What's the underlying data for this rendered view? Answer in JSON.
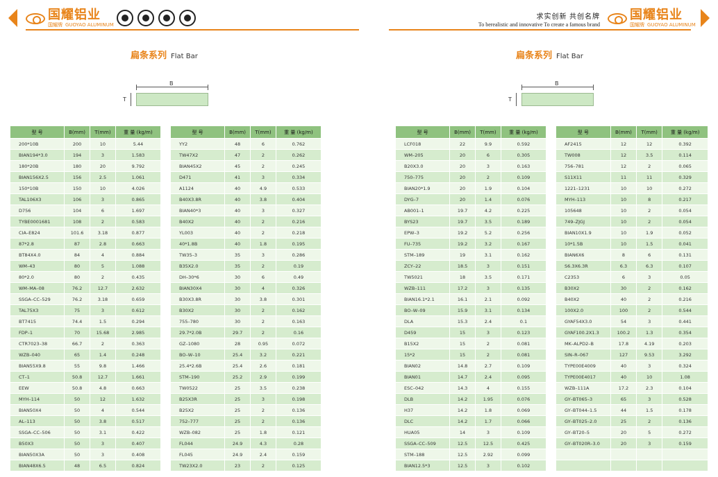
{
  "header": {
    "brand_cn": "国耀铝业",
    "brand_small_cn": "国耀牌",
    "brand_en": "GUOYAO ALUMINUM",
    "slogan_cn": "求实创新  共创名牌",
    "slogan_en": "To berealistic and innovative   To create a famous brand",
    "accent_color": "#e8841a",
    "badge_icons": [
      "certification-seal-icon",
      "ce-mark-icon",
      "quality-gear-icon",
      "triangle-mark-icon"
    ]
  },
  "section": {
    "title_cn": "扁条系列",
    "title_en": "Flat Bar",
    "diagram_label_B": "B",
    "diagram_label_T": "T"
  },
  "columns": [
    "型 号",
    "B(mm)",
    "T(mm)",
    "重 量 (kg/m)"
  ],
  "table1": [
    [
      "200*10B",
      "200",
      "10",
      "5.44"
    ],
    [
      "BIAN194*3.0",
      "194",
      "3",
      "1.583"
    ],
    [
      "180*20B",
      "180",
      "20",
      "9.792"
    ],
    [
      "BIAN156X2.5",
      "156",
      "2.5",
      "1.061"
    ],
    [
      "150*10B",
      "150",
      "10",
      "4.026"
    ],
    [
      "TAL106X3",
      "106",
      "3",
      "0.865"
    ],
    [
      "D756",
      "104",
      "6",
      "1.697"
    ],
    [
      "TYBE0001681",
      "108",
      "2",
      "0.583"
    ],
    [
      "CIA–E824",
      "101.6",
      "3.18",
      "0.877"
    ],
    [
      "87*2.8",
      "87",
      "2.8",
      "0.663"
    ],
    [
      "BT84X4.0",
      "84",
      "4",
      "0.884"
    ],
    [
      "WM–43",
      "80",
      "5",
      "1.088"
    ],
    [
      "80*2.0",
      "80",
      "2",
      "0.435"
    ],
    [
      "WM–MA–08",
      "76.2",
      "12.7",
      "2.632"
    ],
    [
      "SSGA–CC–529",
      "76.2",
      "3.18",
      "0.659"
    ],
    [
      "TAL75X3",
      "75",
      "3",
      "0.612"
    ],
    [
      "BT7415",
      "74.4",
      "1.5",
      "0.294"
    ],
    [
      "FDP–1",
      "70",
      "15.68",
      "2.985"
    ],
    [
      "CTR7023–38",
      "66.7",
      "2",
      "0.363"
    ],
    [
      "WZB–040",
      "65",
      "1.4",
      "0.248"
    ],
    [
      "BIAN55X9.8",
      "55",
      "9.8",
      "1.466"
    ],
    [
      "CT–1",
      "50.8",
      "12.7",
      "1.661"
    ],
    [
      "EEW",
      "50.8",
      "4.8",
      "0.663"
    ],
    [
      "MYH–114",
      "50",
      "12",
      "1.632"
    ],
    [
      "BIAN50X4",
      "50",
      "4",
      "0.544"
    ],
    [
      "AL–113",
      "50",
      "3.8",
      "0.517"
    ],
    [
      "SSGA–CC–506",
      "50",
      "3.1",
      "0.422"
    ],
    [
      "B50X3",
      "50",
      "3",
      "0.407"
    ],
    [
      "BIAN50X3A",
      "50",
      "3",
      "0.408"
    ],
    [
      "BIAN48X6.5",
      "48",
      "6.5",
      "0.824"
    ]
  ],
  "table2": [
    [
      "YY2",
      "48",
      "6",
      "0.762"
    ],
    [
      "TW47X2",
      "47",
      "2",
      "0.262"
    ],
    [
      "BIAN45X2",
      "45",
      "2",
      "0.245"
    ],
    [
      "D471",
      "41",
      "3",
      "0.334"
    ],
    [
      "A1124",
      "40",
      "4.9",
      "0.533"
    ],
    [
      "B40X3.8R",
      "40",
      "3.8",
      "0.404"
    ],
    [
      "BIAN40*3",
      "40",
      "3",
      "0.327"
    ],
    [
      "B40X2",
      "40",
      "2",
      "0.216"
    ],
    [
      "YL003",
      "40",
      "2",
      "0.218"
    ],
    [
      "40*1.8B",
      "40",
      "1.8",
      "0.195"
    ],
    [
      "TW35–3",
      "35",
      "3",
      "0.286"
    ],
    [
      "B35X2.0",
      "35",
      "2",
      "0.19"
    ],
    [
      "DH–30*6",
      "30",
      "6",
      "0.49"
    ],
    [
      "BIAN30X4",
      "30",
      "4",
      "0.326"
    ],
    [
      "B30X3.8R",
      "30",
      "3.8",
      "0.301"
    ],
    [
      "B30X2",
      "30",
      "2",
      "0.162"
    ],
    [
      "755–780",
      "30",
      "2",
      "0.163"
    ],
    [
      "29.7*2.0B",
      "29.7",
      "2",
      "0.16"
    ],
    [
      "GZ–1080",
      "28",
      "0.95",
      "0.072"
    ],
    [
      "BO–W–10",
      "25.4",
      "3.2",
      "0.221"
    ],
    [
      "25.4*2.6B",
      "25.4",
      "2.6",
      "0.181"
    ],
    [
      "STM–190",
      "25.2",
      "2.9",
      "0.199"
    ],
    [
      "TW0522",
      "25",
      "3.5",
      "0.238"
    ],
    [
      "B25X3R",
      "25",
      "3",
      "0.198"
    ],
    [
      "B25X2",
      "25",
      "2",
      "0.136"
    ],
    [
      "752–777",
      "25",
      "2",
      "0.136"
    ],
    [
      "WZB–082",
      "25",
      "1.8",
      "0.121"
    ],
    [
      "FL044",
      "24.9",
      "4.3",
      "0.28"
    ],
    [
      "FL045",
      "24.9",
      "2.4",
      "0.159"
    ],
    [
      "TW23X2.0",
      "23",
      "2",
      "0.125"
    ]
  ],
  "table3": [
    [
      "LCF018",
      "22",
      "9.9",
      "0.592"
    ],
    [
      "WM–205",
      "20",
      "6",
      "0.305"
    ],
    [
      "B20X3.0",
      "20",
      "3",
      "0.163"
    ],
    [
      "750–775",
      "20",
      "2",
      "0.109"
    ],
    [
      "BIAN20*1.9",
      "20",
      "1.9",
      "0.104"
    ],
    [
      "DYG–7",
      "20",
      "1.4",
      "0.076"
    ],
    [
      "AB001–1",
      "19.7",
      "4.2",
      "0.225"
    ],
    [
      "BYS23",
      "19.7",
      "3.5",
      "0.189"
    ],
    [
      "EPW–3",
      "19.2",
      "5.2",
      "0.256"
    ],
    [
      "FU–735",
      "19.2",
      "3.2",
      "0.167"
    ],
    [
      "STM–189",
      "19",
      "3.1",
      "0.162"
    ],
    [
      "ZCY–22",
      "18.5",
      "3",
      "0.151"
    ],
    [
      "TW5021",
      "18",
      "3.5",
      "0.171"
    ],
    [
      "WZB–111",
      "17.2",
      "3",
      "0.135"
    ],
    [
      "BIAN16.1*2.1",
      "16.1",
      "2.1",
      "0.092"
    ],
    [
      "BO–W–09",
      "15.9",
      "3.1",
      "0.134"
    ],
    [
      "DLA",
      "15.3",
      "2.4",
      "0.1"
    ],
    [
      "D459",
      "15",
      "3",
      "0.123"
    ],
    [
      "B15X2",
      "15",
      "2",
      "0.081"
    ],
    [
      "15*2",
      "15",
      "2",
      "0.081"
    ],
    [
      "BIAN02",
      "14.8",
      "2.7",
      "0.109"
    ],
    [
      "BIAN01",
      "14.7",
      "2.4",
      "0.095"
    ],
    [
      "ESC–042",
      "14.3",
      "4",
      "0.155"
    ],
    [
      "DLB",
      "14.2",
      "1.95",
      "0.076"
    ],
    [
      "H37",
      "14.2",
      "1.8",
      "0.069"
    ],
    [
      "DLC",
      "14.2",
      "1.7",
      "0.066"
    ],
    [
      "HUA05",
      "14",
      "3",
      "0.109"
    ],
    [
      "SSGA–CC–509",
      "12.5",
      "12.5",
      "0.425"
    ],
    [
      "STM–188",
      "12.5",
      "2.92",
      "0.099"
    ],
    [
      "BIAN12.5*3",
      "12.5",
      "3",
      "0.102"
    ]
  ],
  "table4": [
    [
      "AF2415",
      "12",
      "12",
      "0.392"
    ],
    [
      "TW008",
      "12",
      "3.5",
      "0.114"
    ],
    [
      "756–781",
      "12",
      "2",
      "0.065"
    ],
    [
      "S11X11",
      "11",
      "11",
      "0.329"
    ],
    [
      "1221–1231",
      "10",
      "10",
      "0.272"
    ],
    [
      "MYH–113",
      "10",
      "8",
      "0.217"
    ],
    [
      "105648",
      "10",
      "2",
      "0.054"
    ],
    [
      "749–ZJGJ",
      "10",
      "2",
      "0.054"
    ],
    [
      "BIAN10X1.9",
      "10",
      "1.9",
      "0.052"
    ],
    [
      "10*1.5B",
      "10",
      "1.5",
      "0.041"
    ],
    [
      "BIAN6X6",
      "8",
      "6",
      "0.131"
    ],
    [
      "S6.3X6.3R",
      "6.3",
      "6.3",
      "0.107"
    ],
    [
      "C2353",
      "6",
      "3",
      "0.05"
    ],
    [
      "B30X2",
      "30",
      "2",
      "0.162"
    ],
    [
      "B40X2",
      "40",
      "2",
      "0.216"
    ],
    [
      "100X2.0",
      "100",
      "2",
      "0.544"
    ],
    [
      "GYAF54X3.0",
      "54",
      "3",
      "0.441"
    ],
    [
      "GYAF100.2X1.3",
      "100.2",
      "1.3",
      "0.354"
    ],
    [
      "MK–ALPD2–B",
      "17.8",
      "4.19",
      "0.203"
    ],
    [
      "SIN–R–067",
      "127",
      "9.53",
      "3.292"
    ],
    [
      "TYPE00E4009",
      "40",
      "3",
      "0.324"
    ],
    [
      "TYPE00E4017",
      "40",
      "10",
      "1.08"
    ],
    [
      "WZB–111A",
      "17.2",
      "2.3",
      "0.104"
    ],
    [
      "GY–BT065–3",
      "65",
      "3",
      "0.528"
    ],
    [
      "GY–BT044–1.5",
      "44",
      "1.5",
      "0.178"
    ],
    [
      "GY–BT025–2.0",
      "25",
      "2",
      "0.136"
    ],
    [
      "GY–BT20–5",
      "20",
      "5",
      "0.272"
    ],
    [
      "GY–BT020R–3.0",
      "20",
      "3",
      "0.159"
    ],
    [
      "",
      "",
      "",
      ""
    ],
    [
      "",
      "",
      "",
      ""
    ]
  ]
}
